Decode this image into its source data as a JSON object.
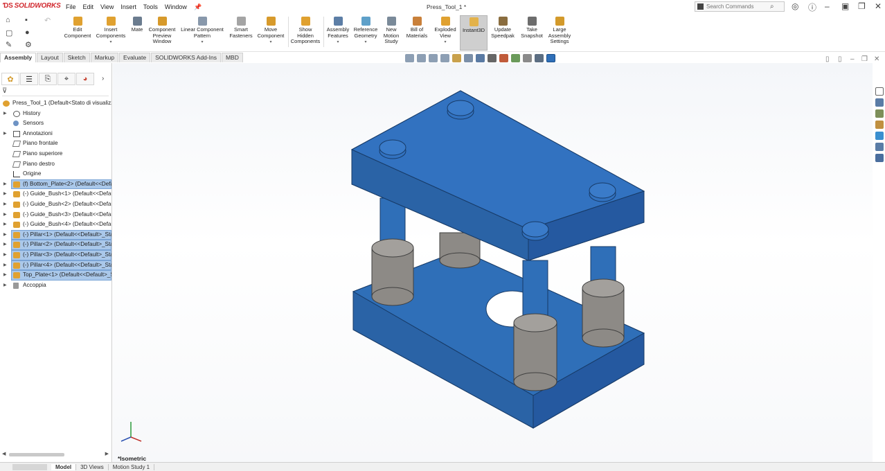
{
  "app": {
    "logo": "SOLIDWORKS",
    "menu": [
      "File",
      "Edit",
      "View",
      "Insert",
      "Tools",
      "Window"
    ],
    "document_title": "Press_Tool_1 *",
    "search_placeholder": "Search Commands"
  },
  "toolbar": {
    "buttons": [
      {
        "label": "Edit Component",
        "icon": "edit-component-icon"
      },
      {
        "label": "Insert Components",
        "icon": "insert-components-icon"
      },
      {
        "label": "Mate",
        "icon": "mate-icon"
      },
      {
        "label": "Component Preview Window",
        "icon": "preview-window-icon"
      },
      {
        "label": "Linear Component Pattern",
        "icon": "linear-pattern-icon"
      },
      {
        "label": "Smart Fasteners",
        "icon": "smart-fasteners-icon"
      },
      {
        "label": "Move Component",
        "icon": "move-component-icon"
      },
      {
        "label": "Show Hidden Components",
        "icon": "show-hidden-icon"
      },
      {
        "label": "Assembly Features",
        "icon": "assembly-features-icon"
      },
      {
        "label": "Reference Geometry",
        "icon": "reference-geometry-icon"
      },
      {
        "label": "New Motion Study",
        "icon": "motion-study-icon"
      },
      {
        "label": "Bill of Materials",
        "icon": "bom-icon"
      },
      {
        "label": "Exploded View",
        "icon": "exploded-view-icon"
      },
      {
        "label": "Instant3D",
        "icon": "instant3d-icon",
        "active": true
      },
      {
        "label": "Update Speedpak",
        "icon": "speedpak-icon"
      },
      {
        "label": "Take Snapshot",
        "icon": "snapshot-icon"
      },
      {
        "label": "Large Assembly Settings",
        "icon": "large-assembly-icon"
      }
    ]
  },
  "tabs": [
    "Assembly",
    "Layout",
    "Sketch",
    "Markup",
    "Evaluate",
    "SOLIDWORKS Add-Ins",
    "MBD"
  ],
  "active_tab": "Assembly",
  "tree": {
    "root": "Press_Tool_1  (Default<Stato di visualizza",
    "items": [
      {
        "label": "History",
        "icon": "history-icon",
        "expander": true
      },
      {
        "label": "Sensors",
        "icon": "sensor-icon",
        "expander": false
      },
      {
        "label": "Annotazioni",
        "icon": "annotations-icon",
        "expander": true
      },
      {
        "label": "Piano frontale",
        "icon": "plane-icon",
        "expander": false
      },
      {
        "label": "Piano superiore",
        "icon": "plane-icon",
        "expander": false
      },
      {
        "label": "Piano destro",
        "icon": "plane-icon",
        "expander": false
      },
      {
        "label": "Origine",
        "icon": "origin-icon",
        "expander": false
      },
      {
        "label": "(f) Bottom_Plate<2> (Default<<Defa",
        "icon": "part-icon",
        "expander": true,
        "selected": true
      },
      {
        "label": "(-) Guide_Bush<1> (Default<<Defau",
        "icon": "part-icon",
        "expander": true
      },
      {
        "label": "(-) Guide_Bush<2> (Default<<Defau",
        "icon": "part-icon",
        "expander": true
      },
      {
        "label": "(-) Guide_Bush<3> (Default<<Defau",
        "icon": "part-icon",
        "expander": true
      },
      {
        "label": "(-) Guide_Bush<4> (Default<<Defau",
        "icon": "part-icon",
        "expander": true
      },
      {
        "label": "(-) Pillar<1> (Default<<Default>_Sta",
        "icon": "part-icon",
        "expander": true,
        "selected": true
      },
      {
        "label": "(-) Pillar<2> (Default<<Default>_Sta",
        "icon": "part-icon",
        "expander": true,
        "selected": true
      },
      {
        "label": "(-) Pillar<3> (Default<<Default>_Sta",
        "icon": "part-icon",
        "expander": true,
        "selected": true
      },
      {
        "label": "(-) Pillar<4> (Default<<Default>_Sta",
        "icon": "part-icon",
        "expander": true,
        "selected": true
      },
      {
        "label": "Top_Plate<1> (Default<<Default>_S",
        "icon": "part-icon",
        "expander": true,
        "selected": true
      },
      {
        "label": "Accoppia",
        "icon": "mates-icon",
        "expander": true
      }
    ]
  },
  "view": {
    "orientation_label": "*Isometric"
  },
  "colors": {
    "part_blue": "#2f6fb8",
    "bush_gray": "#8d8a86",
    "selection": "#aac8ea"
  },
  "bottom_tabs": [
    "Model",
    "3D Views",
    "Motion Study 1"
  ],
  "active_bottom_tab": "Model"
}
